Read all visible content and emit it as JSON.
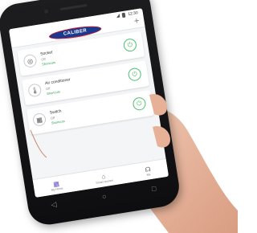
{
  "app": {
    "logo_text": "CALIBER",
    "status_time": "12:30",
    "add_symbol": "+"
  },
  "devices": [
    {
      "name": "Socket",
      "status": "Off",
      "link": "Shortcuts",
      "icon": "socket-icon",
      "glyph": "◎"
    },
    {
      "name": "Air conditioner",
      "status": "Off",
      "link": "Shortcuts",
      "icon": "thermometer-icon",
      "glyph": "🌡"
    },
    {
      "name": "Switch",
      "status": "Off",
      "link": "Shortcuts",
      "icon": "switch-icon",
      "glyph": "▦"
    }
  ],
  "power_glyph": "⏻",
  "nav": [
    {
      "label": "My Home",
      "icon": "grid-icon",
      "glyph": "▦"
    },
    {
      "label": "Smart scenes",
      "icon": "home-icon",
      "glyph": "⌂"
    },
    {
      "label": "Me",
      "icon": "headset-icon",
      "glyph": "☊"
    }
  ],
  "softkeys": [
    "◁",
    "○",
    "□"
  ],
  "colors": {
    "accent": "#4fbf6f",
    "brand": "#1b3a8f",
    "brand_border": "#c71a2a",
    "nav_active": "#6c4fc4",
    "skin": "#e9b9a0"
  }
}
